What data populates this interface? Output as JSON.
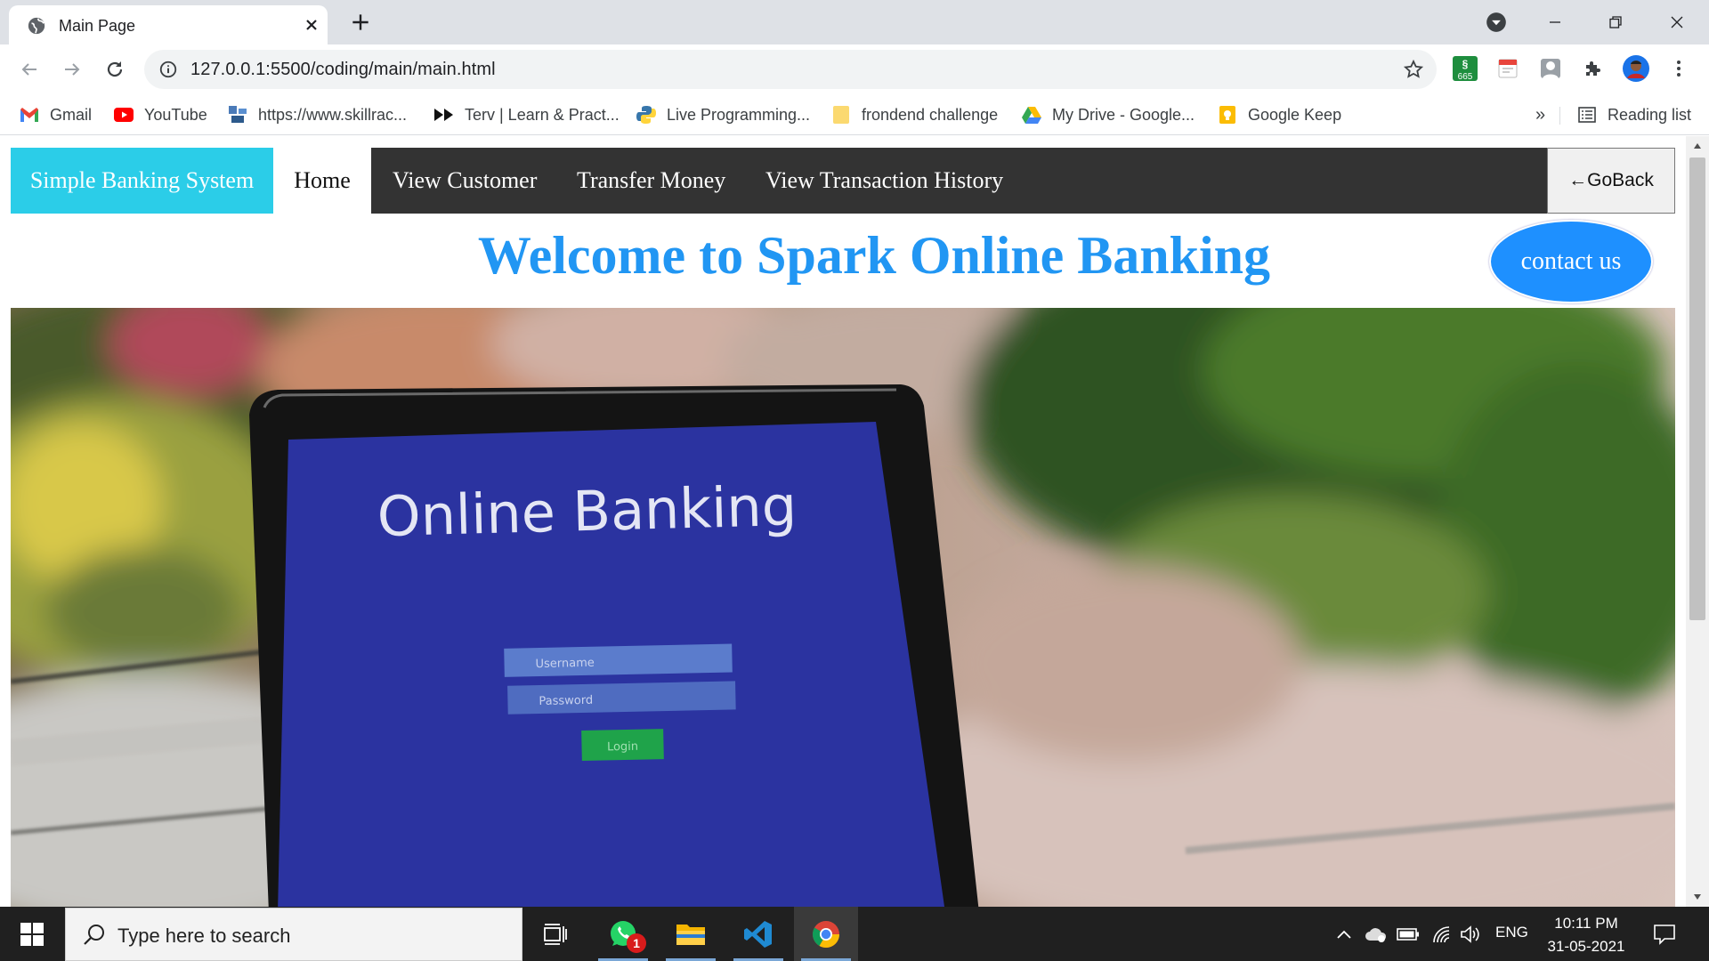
{
  "browser": {
    "tab": {
      "title": "Main Page"
    },
    "address": {
      "url": "127.0.0.1:5500/coding/main/main.html"
    },
    "extensions": {
      "badge_count": "665"
    },
    "bookmarks": [
      {
        "label": "Gmail",
        "icon": "gmail-icon"
      },
      {
        "label": "YouTube",
        "icon": "youtube-icon"
      },
      {
        "label": "https://www.skillrac...",
        "icon": "skillrack-icon"
      },
      {
        "label": "Terv | Learn & Pract...",
        "icon": "terv-icon"
      },
      {
        "label": "Live Programming...",
        "icon": "python-icon"
      },
      {
        "label": "frondend challenge",
        "icon": "folder-icon"
      },
      {
        "label": "My Drive - Google...",
        "icon": "google-drive-icon"
      },
      {
        "label": "Google Keep",
        "icon": "google-keep-icon"
      }
    ],
    "overflow_label": "»",
    "reading_list_label": "Reading list"
  },
  "site": {
    "brand": "Simple Banking System",
    "nav": {
      "home": "Home",
      "view_customer": "View Customer",
      "transfer_money": "Transfer Money",
      "history": "View Transaction History"
    },
    "goback_label": "GoBack",
    "goback_arrow": "←",
    "welcome": "Welcome to Spark Online Banking",
    "contact_label": "contact us",
    "hero": {
      "screen_heading": "Online Banking",
      "username_placeholder": "Username",
      "password_placeholder": "Password",
      "login_label": "Login"
    }
  },
  "taskbar": {
    "search_placeholder": "Type here to search",
    "whatsapp_badge": "1",
    "language": "ENG",
    "time": "10:11 PM",
    "date": "31-05-2021"
  },
  "colors": {
    "brand_bg": "#2bcde8",
    "nav_bg": "#333333",
    "heading": "#2196f3",
    "contact_bg": "#1e90ff",
    "hero_screen": "#2b33a0"
  }
}
